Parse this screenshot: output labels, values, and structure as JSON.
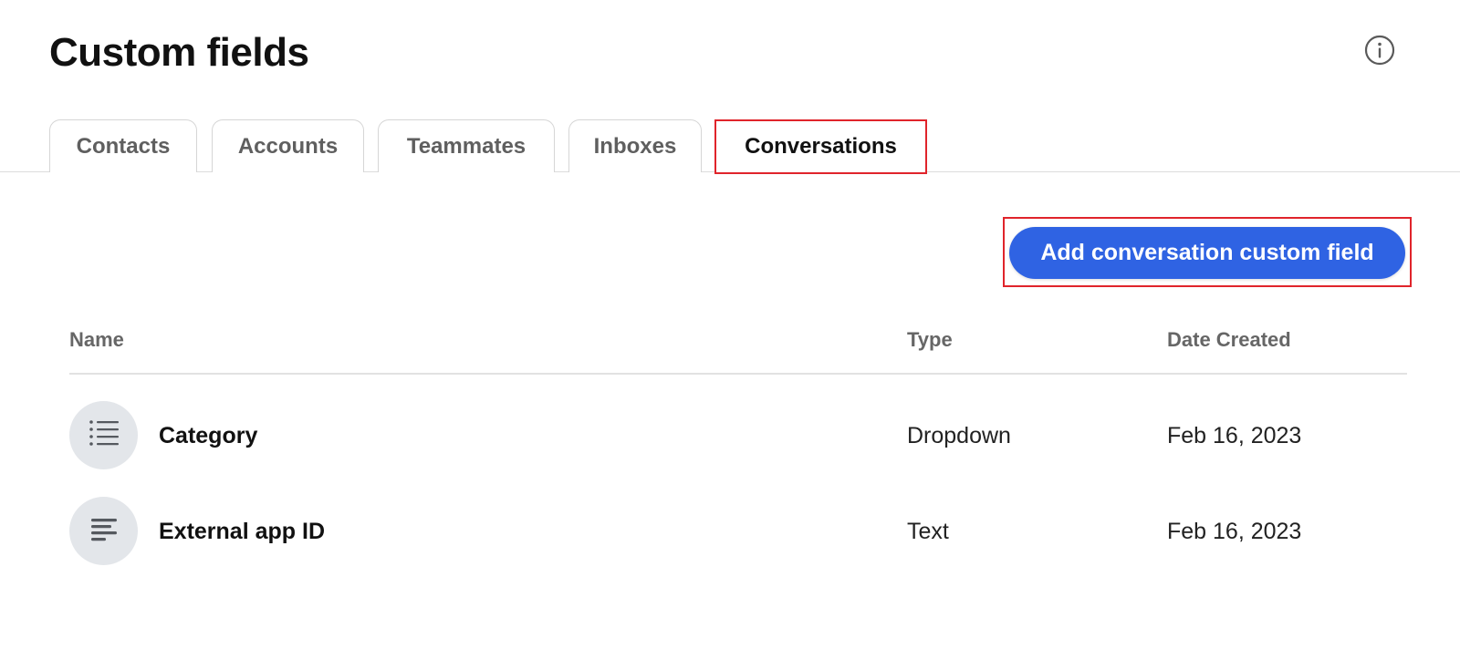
{
  "header": {
    "title": "Custom fields",
    "info_icon": "info-circle-icon"
  },
  "tabs": [
    {
      "label": "Contacts",
      "active": false
    },
    {
      "label": "Accounts",
      "active": false
    },
    {
      "label": "Teammates",
      "active": false
    },
    {
      "label": "Inboxes",
      "active": false
    },
    {
      "label": "Conversations",
      "active": true
    }
  ],
  "actions": {
    "add_label": "Add conversation custom field"
  },
  "table": {
    "columns": {
      "name": "Name",
      "type": "Type",
      "date": "Date Created"
    },
    "rows": [
      {
        "name": "Category",
        "type": "Dropdown",
        "date": "Feb 16, 2023",
        "icon": "list-icon"
      },
      {
        "name": "External app ID",
        "type": "Text",
        "date": "Feb 16, 2023",
        "icon": "text-lines-icon"
      }
    ]
  },
  "colors": {
    "accent": "#2f63e3",
    "highlight": "#e0242b",
    "icon_bg": "#e3e6ea"
  }
}
